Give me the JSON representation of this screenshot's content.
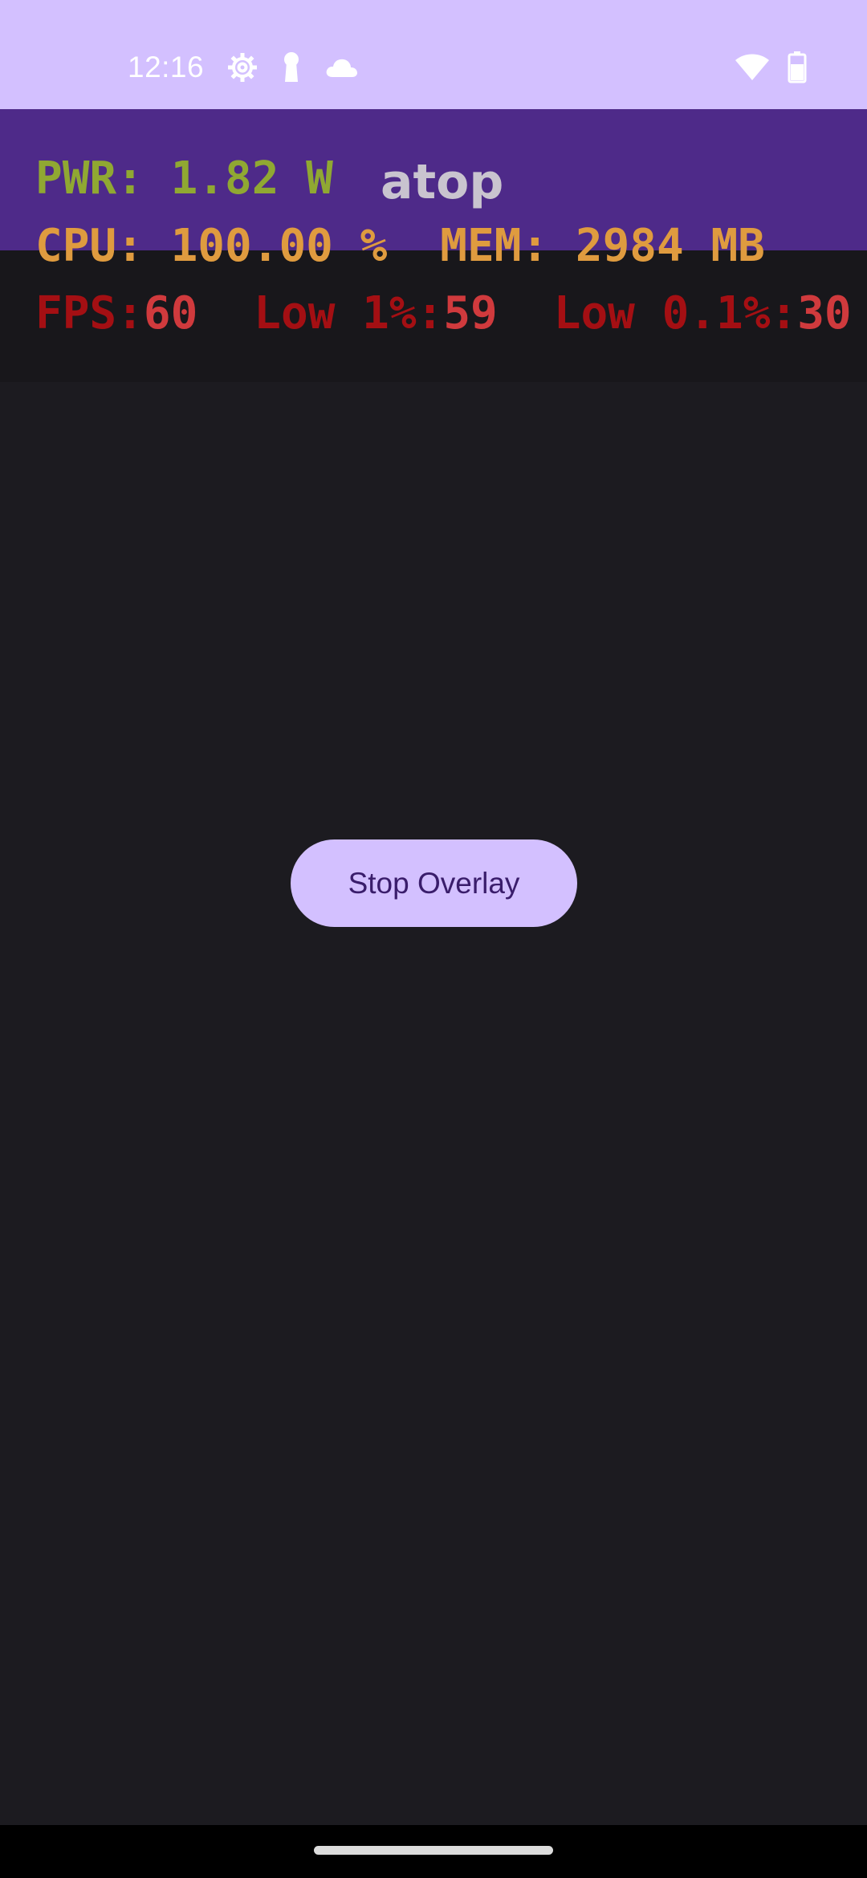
{
  "status_bar": {
    "time": "12:16",
    "left_icons": [
      "settings-gear-icon",
      "keyhole-icon",
      "cloud-icon"
    ],
    "right_icons": [
      "wifi-icon",
      "battery-icon"
    ],
    "background_color": "#d3c0ff"
  },
  "app_bar": {
    "title": "atop",
    "background_color": "#4e2a89"
  },
  "metrics": {
    "pwr": {
      "label": "PWR:",
      "value": "1.82 W",
      "color": "#90a832"
    },
    "cpu": {
      "label": "CPU:",
      "value": "100.00 %",
      "color": "#df9b3f"
    },
    "mem": {
      "label": "MEM:",
      "value": "2984 MB",
      "color": "#df9b3f"
    },
    "fps": {
      "label": "FPS:",
      "value": "60",
      "color": "#a40f13"
    },
    "low1": {
      "label": "Low 1%:",
      "value": "59"
    },
    "low01": {
      "label": "Low 0.1%:",
      "value": "30"
    }
  },
  "main": {
    "stop_button_label": "Stop Overlay",
    "button_color": "#d3c0ff",
    "background_color": "#1c1b20"
  }
}
